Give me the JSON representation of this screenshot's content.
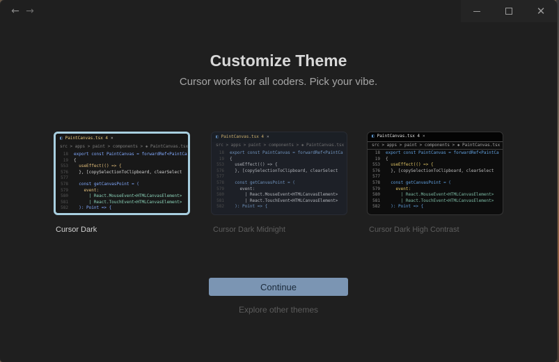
{
  "titlebar": {
    "back_icon": "←",
    "forward_icon": "→",
    "close_glyph": "✕"
  },
  "header": {
    "title": "Customize Theme",
    "subtitle": "Cursor works for all coders. Pick your vibe."
  },
  "preview_content": {
    "tab_label": "PaintCanvas.tsx 4",
    "tab_close": "×",
    "breadcrumb": "src > apps > paint > components > ◈ PaintCanvas.tsx > [ø] P",
    "line_numbers": [
      "18",
      "19",
      "553",
      "576",
      "577",
      "578",
      "579",
      "580",
      "581",
      "582"
    ],
    "lines": [
      "export const PaintCanvas = forwardRef<PaintCa",
      "{",
      "  useEffect(() => {",
      "  }, [copySelectionToClipboard, clearSelect",
      "",
      "  const getCanvasPoint = (",
      "    event:",
      "      | React.MouseEvent<HTMLCanvasElement>",
      "      | React.TouchEvent<HTMLCanvasElement>",
      "  ): Point => {"
    ]
  },
  "themes": [
    {
      "name": "Cursor Dark",
      "selected": true
    },
    {
      "name": "Cursor Dark Midnight",
      "selected": false
    },
    {
      "name": "Cursor Dark High Contrast",
      "selected": false
    }
  ],
  "actions": {
    "continue_label": "Continue",
    "explore_label": "Explore other themes"
  },
  "colors": {
    "accent_button": "#7b95b3",
    "selected_border": "#a8cfe0",
    "window_bg": "#1f1f1f"
  }
}
